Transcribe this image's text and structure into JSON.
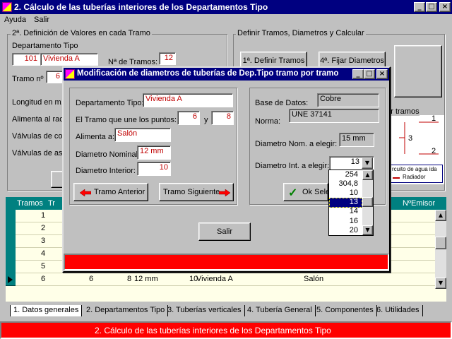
{
  "window": {
    "title": "2. Cálculo de las tuberías interiores de los Departamentos Tipo",
    "minimize": "_",
    "maximize": "□",
    "close": "×"
  },
  "menu": {
    "items": [
      "Ayuda",
      "Salir"
    ]
  },
  "left_group": {
    "title": "2ª. Definición de Valores en cada Tramo",
    "depto_label": "Departamento Tipo",
    "depto_number": "101",
    "depto_name": "Vivienda A",
    "tramos_label": "Nª de Tramos:",
    "tramos_value": "12",
    "tramo_label": "Tramo nº",
    "tramo_value": "6",
    "longitud_label": "Longitud en m.",
    "alimenta_label": "Alimenta al rad",
    "valvulas_co_label": "Válvulas de co",
    "valvulas_as_label": "Válvulas de as"
  },
  "right_group": {
    "title": "Definir Tramos, Diametros y Calcular",
    "btn1": "1ª. Definir Tramos",
    "btn4": "4ª. Fijar Diametros",
    "diagram_title": "nar tramos",
    "diagram_n1": "1",
    "diagram_n3": "3",
    "diagram_n2": "2",
    "legend_circuit": "rcuito de agua ida",
    "legend_radiator": "Radiador"
  },
  "grid": {
    "header": {
      "tramos": "Tramos",
      "tr": "Tr",
      "emisores": "NºEmisor"
    },
    "rows": [
      {
        "n": "1"
      },
      {
        "n": "2"
      },
      {
        "n": "3"
      },
      {
        "n": "4"
      },
      {
        "n": "5"
      },
      {
        "n": "6",
        "a": "6",
        "b": "8",
        "diam": "12 mm",
        "int": "10",
        "depto": "Vivienda A",
        "alim": "Salón"
      }
    ]
  },
  "dialog": {
    "title": "Modificación de diametros de tuberías de Dep.Tipo tramo por tramo",
    "depto_label": "Departamento Tipo:",
    "depto_value": "Vivienda A",
    "tramo_label": "El Tramo que une los puntos:",
    "punto1": "6",
    "y_label": "y",
    "punto2": "8",
    "alimenta_label": "Alimenta a:",
    "alimenta_value": "Salón",
    "nominal_label": "Diametro Nominal:",
    "nominal_value": "12 mm",
    "interior_label": "Diametro Interior:",
    "interior_value": "10",
    "prev_button": "Tramo Anterior",
    "next_button": "Tramo Siguiente",
    "db_label": "Base de Datos:",
    "db_value": "Cobre",
    "norma_label": "Norma:",
    "norma_value": "UNE 37141",
    "nom_elegir_label": "Diametro Nom. a elegir:",
    "nom_elegir_value": "15 mm",
    "int_elegir_label": "Diametro Int. a elegir:",
    "int_elegir_value": "13",
    "ok_button": "Ok Sele",
    "salir_button": "Salir",
    "dropdown_options": [
      "254",
      "304,8",
      "10",
      "13",
      "14",
      "16",
      "20"
    ],
    "dropdown_selected": "13"
  },
  "tabs": [
    "1. Datos generales",
    "2. Departamentos Tipo",
    "3. Tuberías verticales",
    "4. Tubería General",
    "5. Componentes",
    "6. Utilidades"
  ],
  "status": {
    "text": "2. Cálculo de las tuberías interiores de los Departamentos Tipo"
  },
  "colors": {
    "titlebar": "#000080",
    "status": "#ff0000",
    "field_text": "#c00000",
    "grid_header": "#008080"
  }
}
